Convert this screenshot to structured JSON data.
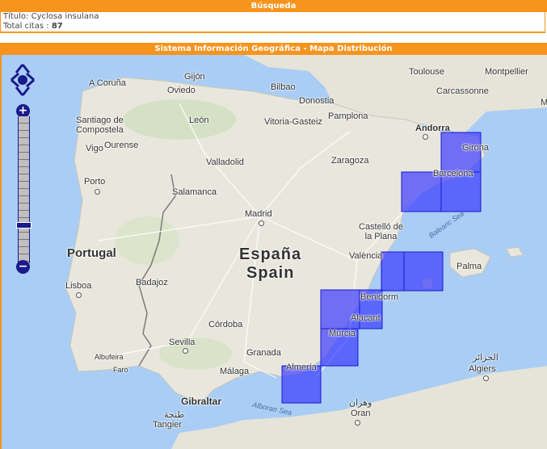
{
  "search": {
    "header": "Búsqueda",
    "title_label": "Título:",
    "title_value": "Cyclosa insulana",
    "count_label": "Total citas :",
    "count_value": "87"
  },
  "map": {
    "header": "Sistema Información Geográfica - Mapa Distribución",
    "zoom_in": "+",
    "zoom_out": "−",
    "labels": {
      "a_coruna": "A Coruña",
      "gijon": "Gijón",
      "oviedo": "Oviedo",
      "bilbao": "Bilbao",
      "donostia": "Donostia",
      "toulouse": "Toulouse",
      "montpellier": "Montpellier",
      "carcassonne": "Carcassonne",
      "santiago": "Santiago de\nCompostela",
      "leon": "León",
      "vitoria": "Vitoria-Gasteiz",
      "pamplona": "Pamplona",
      "ourense": "Ourense",
      "vigo": "Vigo",
      "andorra": "Andorra",
      "girona": "Girona",
      "valladolid": "Valladolid",
      "zaragoza": "Zaragoza",
      "barcelona": "Barcelona",
      "porto": "Porto",
      "salamanca": "Salamanca",
      "madrid": "Madrid",
      "castello": "Castelló de\nla Plana",
      "balearic_sea": "Balearic Sea",
      "portugal": "Portugal",
      "espana": "España",
      "spain": "Spain",
      "valencia": "València",
      "palma": "Palma",
      "lisboa": "Lisboa",
      "badajoz": "Badajoz",
      "benidorm": "Benidorm",
      "alacant": "Alacant",
      "cordoba": "Córdoba",
      "murcia": "Murcia",
      "sevilla": "Sevilla",
      "albufeira": "Albufeira",
      "faro": "Faro",
      "granada": "Granada",
      "malaga": "Málaga",
      "almeria": "Almería",
      "algiers_ar": "الجزائر",
      "algiers": "Algiers",
      "gibraltar": "Gibraltar",
      "alboran": "Alboran Sea",
      "oran_ar": "وهران",
      "oran": "Oran",
      "tangier_ar": "طنجة",
      "tangier": "Tangier",
      "m_edge": "M"
    }
  },
  "colors": {
    "accent": "#f7941d",
    "grid_fill": "#3b3bff",
    "grid_stroke": "#1a1acc",
    "sea": "#a9cdf5",
    "land": "#e9e7dd",
    "control": "#1a1a8c"
  }
}
